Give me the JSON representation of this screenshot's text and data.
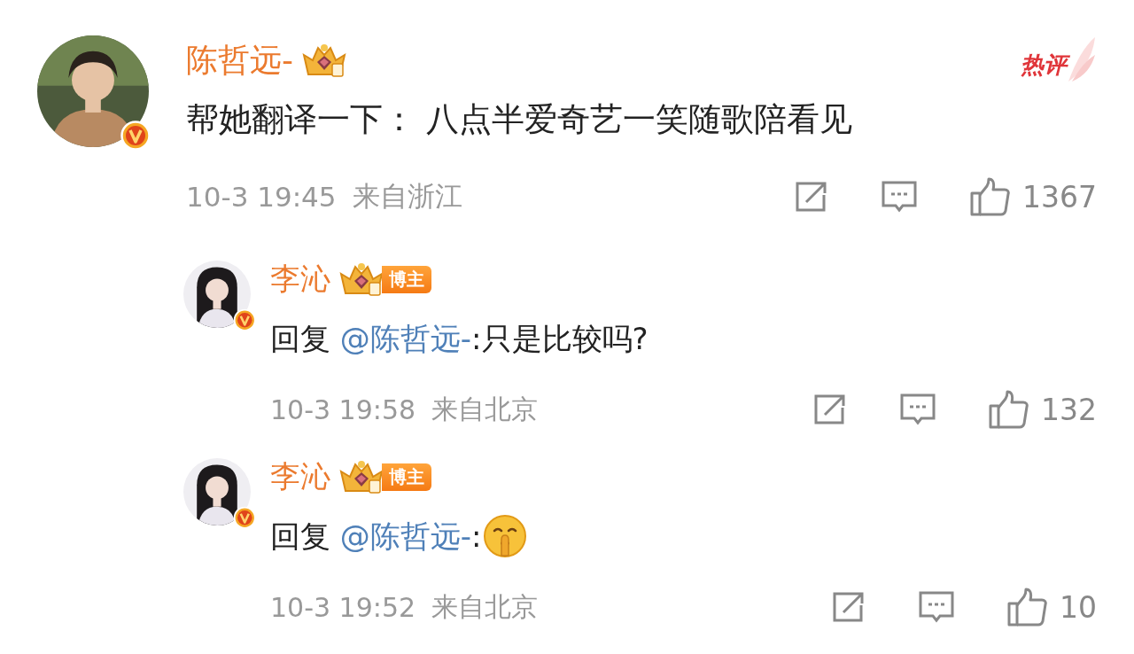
{
  "comments": [
    {
      "author": "陈哲远-",
      "verified": true,
      "tag": "热评",
      "text": "帮她翻译一下： 八点半爱奇艺一笑随歌陪看见",
      "time": "10-3 19:45",
      "location": "来自浙江",
      "likes": "1367",
      "replies": [
        {
          "author": "李沁",
          "verified": true,
          "role_tag": "博主",
          "reply_prefix": "回复",
          "mention": "@陈哲远-",
          "text": ":只是比较吗?",
          "time": "10-3 19:58",
          "location": "来自北京",
          "likes": "132"
        },
        {
          "author": "李沁",
          "verified": true,
          "role_tag": "博主",
          "reply_prefix": "回复",
          "mention": "@陈哲远-",
          "text": ":",
          "shushing_emoji": true,
          "time": "10-3 19:52",
          "location": "来自北京",
          "likes": "10"
        }
      ]
    }
  ]
}
